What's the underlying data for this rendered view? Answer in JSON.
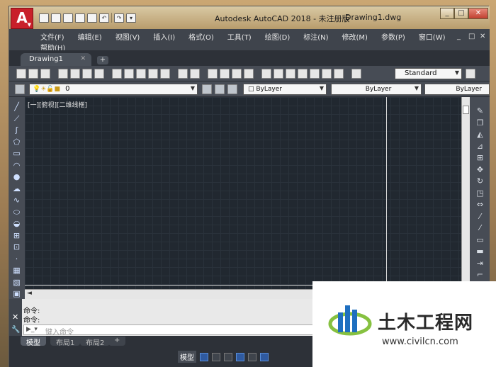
{
  "titlebar": {
    "app_icon": "A",
    "app_title": "Autodesk AutoCAD 2018 - 未注册版",
    "file_name": "Drawing1.dwg",
    "minimize": "_",
    "restore": "□",
    "close": "✕"
  },
  "menu": {
    "items": [
      "文件(F)",
      "编辑(E)",
      "视图(V)",
      "插入(I)",
      "格式(O)",
      "工具(T)",
      "绘图(D)",
      "标注(N)",
      "修改(M)",
      "参数(P)",
      "窗口(W)"
    ],
    "help": "帮助(H)",
    "doc_controls": [
      "_",
      "□",
      "✕"
    ]
  },
  "tabs": {
    "active": "Drawing1",
    "close": "✕",
    "new": "+"
  },
  "toolbar": {
    "text_style": "Standard",
    "layer_value": "0",
    "color": "ByLayer",
    "linetype": "ByLayer",
    "lineweight": "ByLayer"
  },
  "canvas": {
    "viewport_label": "[一][俯视][二维线框]"
  },
  "command": {
    "history": [
      "命令:",
      "命令:"
    ],
    "placeholder": "键入命令"
  },
  "layout_tabs": [
    "模型",
    "布局1",
    "布局2",
    "+"
  ],
  "status": {
    "model": "模型"
  },
  "watermark": {
    "name": "土木工程网",
    "url": "www.civilcn.com"
  },
  "colors": {
    "canvas_bg": "#212830",
    "ui_dark": "#3b4049",
    "app_red": "#c8202a"
  }
}
